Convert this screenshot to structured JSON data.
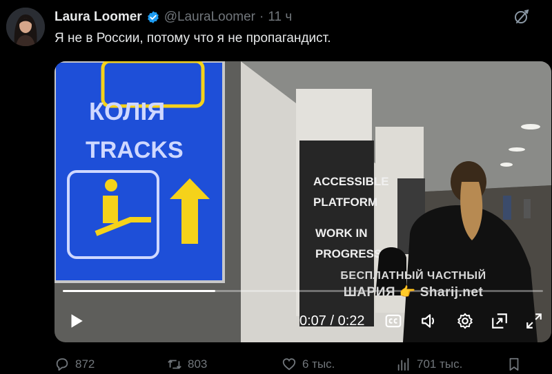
{
  "author": {
    "display_name": "Laura Loomer",
    "handle": "@LauraLoomer",
    "separator": "·",
    "time": "11 ч"
  },
  "tweet": {
    "text": "Я не в России, потому что я не пропагандист."
  },
  "video": {
    "progress": 0.318,
    "timecode": "0:07 / 0:22",
    "scene_text": {
      "sign_line1": "КОЛІЯ",
      "sign_line2": "TRACKS",
      "poster_line1": "ACCESSIBLE",
      "poster_line2": "PLATFORM",
      "poster_line3": "WORK IN",
      "poster_line4": "PROGRESS"
    }
  },
  "watermark": {
    "line1": "БЕСПЛАТНЫЙ ЧАСТНЫЙ",
    "line2": "ШАРИЯ 👉 Sharij.net"
  },
  "actions": {
    "replies": "872",
    "retweets": "803",
    "likes": "6 тыс.",
    "views": "701 тыс."
  },
  "colors": {
    "accent": "#1d9bf0",
    "muted": "#71767b",
    "text": "#e7e9ea",
    "sign_blue": "#1e4fd8",
    "sign_yellow": "#f5d21a"
  }
}
